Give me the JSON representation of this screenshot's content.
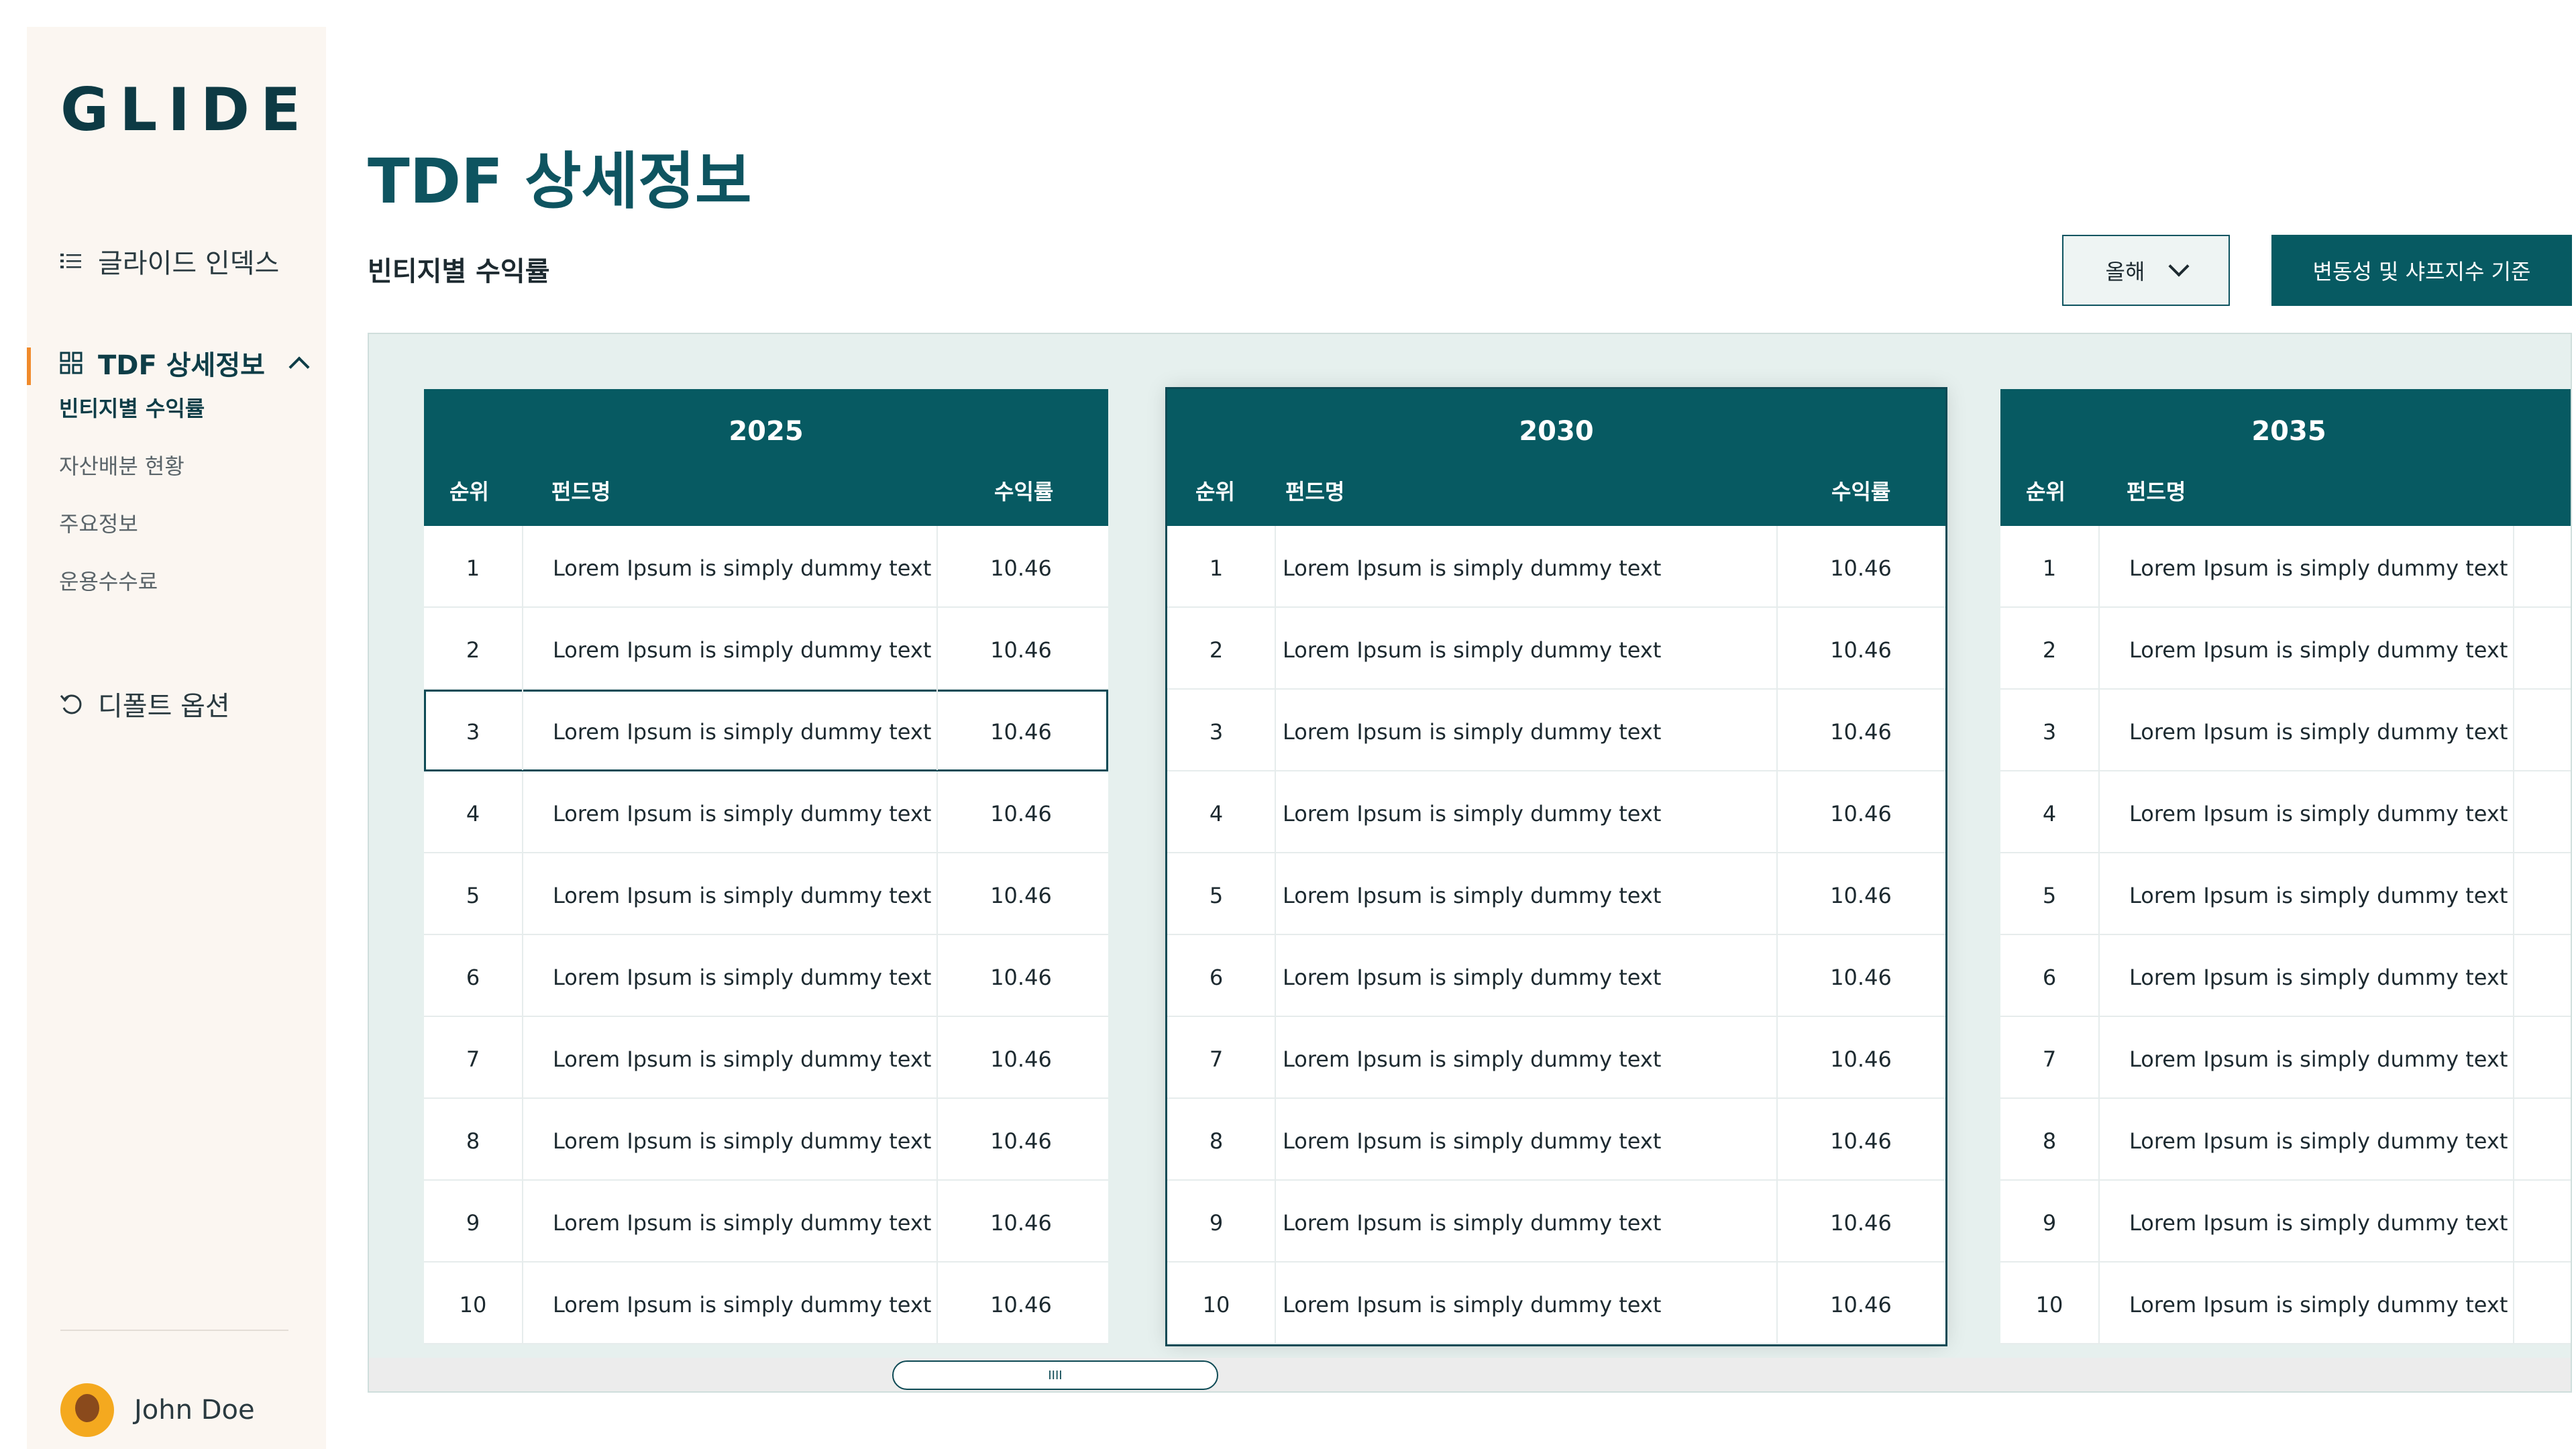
{
  "app": {
    "logo": "GLIDE"
  },
  "sidebar": {
    "index_label": "글라이드 인덱스",
    "tdf_label": "TDF 상세정보",
    "sub_items": [
      "빈티지별 수익률",
      "자산배분 현황",
      "주요정보",
      "운용수수료"
    ],
    "defaults_label": "디폴트 옵션",
    "user_name": "John Doe"
  },
  "header": {
    "title": "TDF 상세정보",
    "section_title": "빈티지별 수익률",
    "period_select": "올해",
    "cta_label": "변동성 및 샤프지수 기준"
  },
  "table_columns": {
    "rank": "순위",
    "fund": "펀드명",
    "return": "수익률"
  },
  "tables": [
    {
      "year": "2025",
      "rows": [
        {
          "rank": "1",
          "name": "Lorem Ipsum is simply dummy text",
          "rate": "10.46"
        },
        {
          "rank": "2",
          "name": "Lorem Ipsum is simply dummy text",
          "rate": "10.46"
        },
        {
          "rank": "3",
          "name": "Lorem Ipsum is simply dummy text",
          "rate": "10.46"
        },
        {
          "rank": "4",
          "name": "Lorem Ipsum is simply dummy text",
          "rate": "10.46"
        },
        {
          "rank": "5",
          "name": "Lorem Ipsum is simply dummy text",
          "rate": "10.46"
        },
        {
          "rank": "6",
          "name": "Lorem Ipsum is simply dummy text",
          "rate": "10.46"
        },
        {
          "rank": "7",
          "name": "Lorem Ipsum is simply dummy text",
          "rate": "10.46"
        },
        {
          "rank": "8",
          "name": "Lorem Ipsum is simply dummy text",
          "rate": "10.46"
        },
        {
          "rank": "9",
          "name": "Lorem Ipsum is simply dummy text",
          "rate": "10.46"
        },
        {
          "rank": "10",
          "name": "Lorem Ipsum is simply dummy text",
          "rate": "10.46"
        }
      ]
    },
    {
      "year": "2030",
      "rows": [
        {
          "rank": "1",
          "name": "Lorem Ipsum is simply dummy text",
          "rate": "10.46"
        },
        {
          "rank": "2",
          "name": "Lorem Ipsum is simply dummy text",
          "rate": "10.46"
        },
        {
          "rank": "3",
          "name": "Lorem Ipsum is simply dummy text",
          "rate": "10.46"
        },
        {
          "rank": "4",
          "name": "Lorem Ipsum is simply dummy text",
          "rate": "10.46"
        },
        {
          "rank": "5",
          "name": "Lorem Ipsum is simply dummy text",
          "rate": "10.46"
        },
        {
          "rank": "6",
          "name": "Lorem Ipsum is simply dummy text",
          "rate": "10.46"
        },
        {
          "rank": "7",
          "name": "Lorem Ipsum is simply dummy text",
          "rate": "10.46"
        },
        {
          "rank": "8",
          "name": "Lorem Ipsum is simply dummy text",
          "rate": "10.46"
        },
        {
          "rank": "9",
          "name": "Lorem Ipsum is simply dummy text",
          "rate": "10.46"
        },
        {
          "rank": "10",
          "name": "Lorem Ipsum is simply dummy text",
          "rate": "10.46"
        }
      ]
    },
    {
      "year": "2035",
      "rows": [
        {
          "rank": "1",
          "name": "Lorem Ipsum is simply dummy text"
        },
        {
          "rank": "2",
          "name": "Lorem Ipsum is simply dummy text"
        },
        {
          "rank": "3",
          "name": "Lorem Ipsum is simply dummy text"
        },
        {
          "rank": "4",
          "name": "Lorem Ipsum is simply dummy text"
        },
        {
          "rank": "5",
          "name": "Lorem Ipsum is simply dummy text"
        },
        {
          "rank": "6",
          "name": "Lorem Ipsum is simply dummy text"
        },
        {
          "rank": "7",
          "name": "Lorem Ipsum is simply dummy text"
        },
        {
          "rank": "8",
          "name": "Lorem Ipsum is simply dummy text"
        },
        {
          "rank": "9",
          "name": "Lorem Ipsum is simply dummy text"
        },
        {
          "rank": "10",
          "name": "Lorem Ipsum is simply dummy text"
        }
      ]
    }
  ],
  "scrollbar": {
    "grip": "IIII"
  },
  "colors": {
    "brand": "#075a62",
    "accent": "#f08a2b",
    "panel_bg": "#e6f0ee",
    "sidebar_bg": "#fbf6f1"
  },
  "icons": {
    "index": "list-icon",
    "tdf": "grid-icon",
    "defaults": "reset-icon",
    "expand": "chevron-up-icon",
    "dropdown": "chevron-down-icon"
  }
}
